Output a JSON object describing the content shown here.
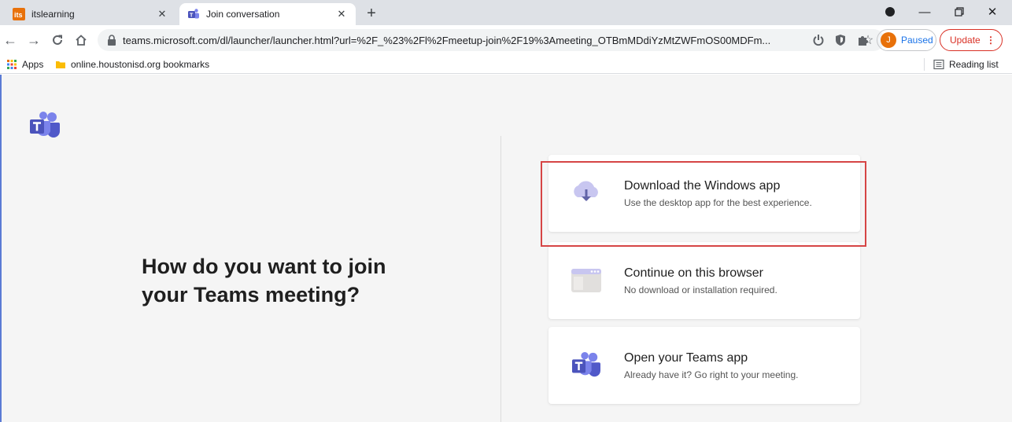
{
  "browser": {
    "tabs": [
      {
        "title": "itslearning",
        "favicon": "itslearning-favicon",
        "active": false
      },
      {
        "title": "Join conversation",
        "favicon": "teams-favicon",
        "active": true
      }
    ],
    "new_tab_icon": "plus-icon",
    "url": "teams.microsoft.com/dl/launcher/launcher.html?url=%2F_%23%2Fl%2Fmeetup-join%2F19%3Ameeting_OTBmMDdiYzMtZWFmOS00MDFm...",
    "profile": {
      "initial": "J",
      "status": "Paused"
    },
    "update_label": "Update",
    "bookmarks": {
      "apps_label": "Apps",
      "folder_label": "online.houstonisd.org bookmarks",
      "reading_list_label": "Reading list"
    }
  },
  "page": {
    "headline_line1": "How do you want to join",
    "headline_line2": "your Teams meeting?",
    "options": [
      {
        "title": "Download the Windows app",
        "subtitle": "Use the desktop app for the best experience.",
        "icon": "download-cloud-icon"
      },
      {
        "title": "Continue on this browser",
        "subtitle": "No download or installation required.",
        "icon": "browser-window-icon"
      },
      {
        "title": "Open your Teams app",
        "subtitle": "Already have it? Go right to your meeting.",
        "icon": "teams-icon"
      }
    ]
  },
  "colors": {
    "teams_purple": "#5b5fc7",
    "highlight_red": "#d64545",
    "update_red": "#d93025"
  }
}
